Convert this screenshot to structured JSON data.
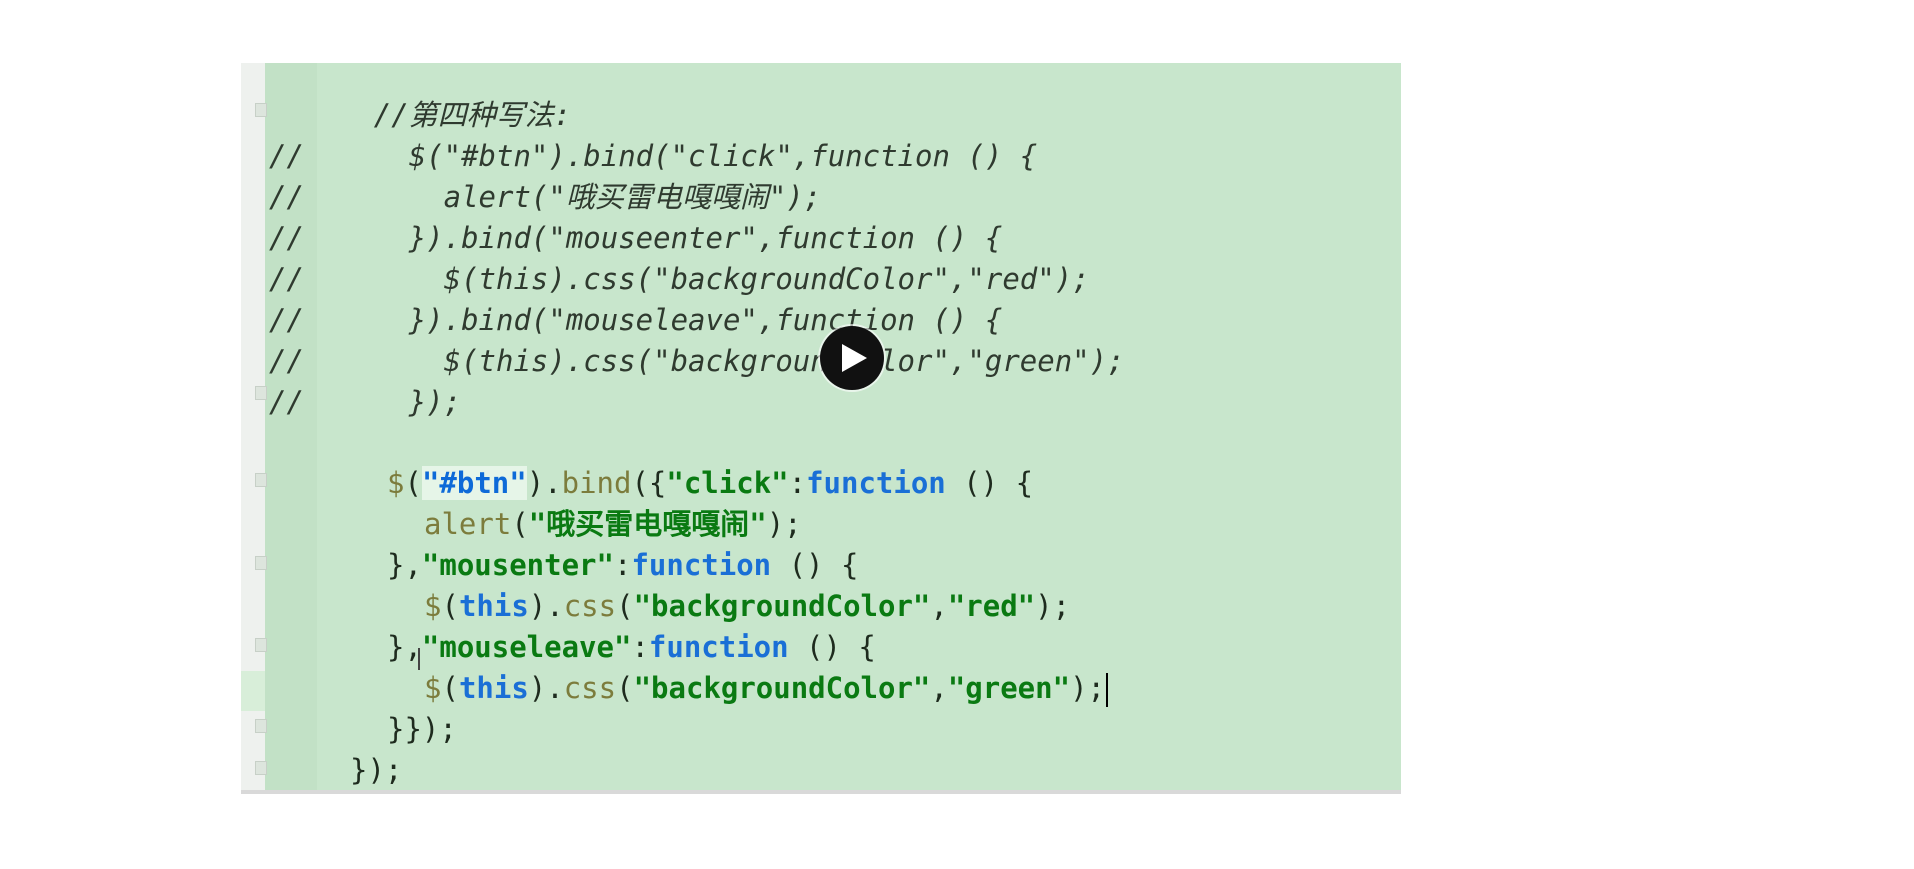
{
  "editor": {
    "lines": [
      {
        "indent": "      ",
        "prefix": "",
        "text": "//第四种写法:"
      },
      {
        "prefix": "//",
        "indent": "      ",
        "text": "$(\"#btn\").bind(\"click\",function () {"
      },
      {
        "prefix": "//",
        "indent": "        ",
        "text": "alert(\"哦买雷电嘎嘎闹\");"
      },
      {
        "prefix": "//",
        "indent": "      ",
        "text": "}).bind(\"mouseenter\",function () {"
      },
      {
        "prefix": "//",
        "indent": "        ",
        "text": "$(this).css(\"backgroundColor\",\"red\");"
      },
      {
        "prefix": "//",
        "indent": "      ",
        "text": "}).bind(\"mouseleave\",function () {"
      },
      {
        "prefix": "//",
        "indent": "        ",
        "text": "$(this).css(\"backgroundColor\",\"green\");"
      },
      {
        "prefix": "//",
        "indent": "      ",
        "text": "});"
      }
    ],
    "active": {
      "l1": {
        "dollar": "$",
        "open": "(",
        "sel": "\"#btn\"",
        "close": ").",
        "bind": "bind",
        "brace": "({",
        "key": "\"click\"",
        "colon": ":",
        "kw": "function",
        "rest": " () {"
      },
      "l2": {
        "alert": "alert",
        "open": "(",
        "str": "\"哦买雷电嘎嘎闹\"",
        "close": ");"
      },
      "l3": {
        "lead": "},",
        "key": "\"mousenter\"",
        "colon": ":",
        "kw": "function",
        "rest": " () {"
      },
      "l4": {
        "dollar": "$",
        "open": "(",
        "this": "this",
        "dot": ").",
        "css": "css",
        "p1": "(",
        "s1": "\"backgroundColor\"",
        "comma": ",",
        "s2": "\"red\"",
        "close": ");"
      },
      "l5": {
        "lead": "},",
        "key": "\"mouseleave\"",
        "colon": ":",
        "kw": "function",
        "rest": " () {"
      },
      "l6": {
        "dollar": "$",
        "open": "(",
        "this": "this",
        "dot": ").",
        "css": "css",
        "p1": "(",
        "s1": "\"backgroundColor\"",
        "comma": ",",
        "s2": "\"green\"",
        "close": ");"
      },
      "l7": {
        "text": "}});"
      },
      "l8": {
        "text": "});"
      }
    }
  },
  "icons": {
    "play": "play-icon"
  },
  "colors": {
    "editor_bg": "#c8e6cc",
    "string": "#0a7a12",
    "keyword": "#1a6fd6",
    "selector": "#0e6ad8"
  }
}
